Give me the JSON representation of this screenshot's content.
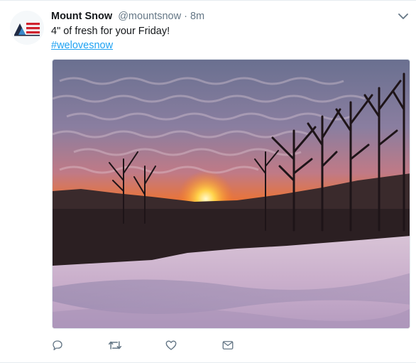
{
  "tweet": {
    "author": {
      "name": "Mount Snow",
      "handle": "@mountsnow",
      "avatar_icon": "mount-snow-logo-icon"
    },
    "separator": "·",
    "timestamp": "8m",
    "text": "4\" of fresh for your Friday!",
    "hashtag": "#welovesnow",
    "menu_icon": "chevron-down-icon",
    "media": {
      "kind": "photo",
      "subject": "sunset over snowy ski slope"
    },
    "actions": [
      {
        "name": "reply-icon"
      },
      {
        "name": "retweet-icon"
      },
      {
        "name": "like-icon"
      },
      {
        "name": "message-icon"
      }
    ]
  },
  "colors": {
    "link": "#1da1f2",
    "secondary_text": "#657786",
    "primary_text": "#14171a",
    "icon": "#657786",
    "logo_navy": "#1f2a44",
    "logo_red": "#d0212d",
    "logo_blue": "#3a89c9"
  }
}
